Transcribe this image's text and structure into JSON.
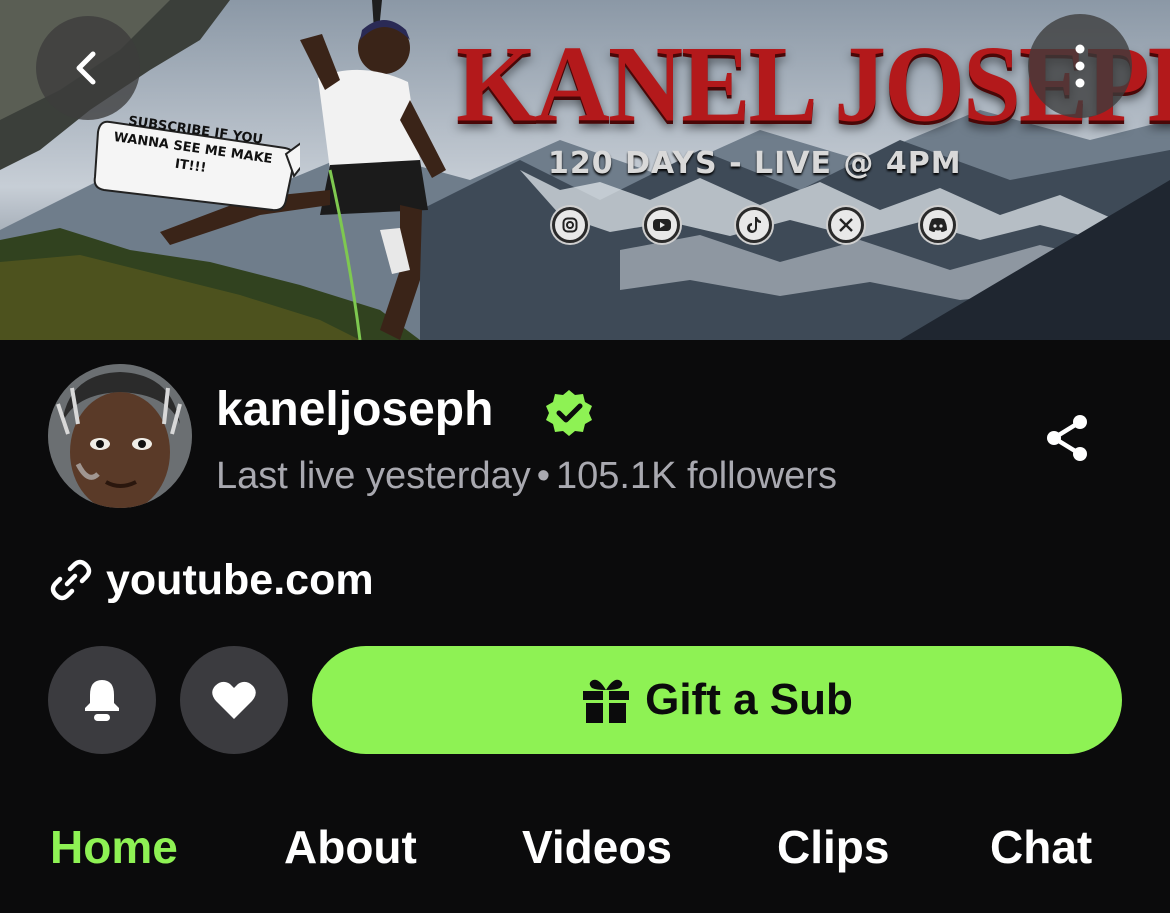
{
  "banner": {
    "title": "KANEL JOSEPH",
    "subtitle": "120 DAYS - LIVE @ 4PM",
    "bubble_text": "SUBSCRIBE IF YOU WANNA SEE ME MAKE IT!!!",
    "socials": [
      "instagram-icon",
      "youtube-icon",
      "tiktok-icon",
      "x-icon",
      "discord-icon"
    ]
  },
  "nav": {
    "back_icon": "chevron-left-icon",
    "more_icon": "more-vertical-icon"
  },
  "profile": {
    "username": "kaneljoseph",
    "last_live": "Last live yesterday",
    "separator": "•",
    "followers": "105.1K followers",
    "link": "youtube.com"
  },
  "actions": {
    "gift_label": "Gift a Sub"
  },
  "tabs": [
    "Home",
    "About",
    "Videos",
    "Clips",
    "Chat"
  ],
  "colors": {
    "accent": "#8ef254",
    "background": "#0b0b0c",
    "button_bg": "#3b3b3f",
    "muted_text": "#a9a9b0",
    "banner_title": "#b3191b"
  }
}
